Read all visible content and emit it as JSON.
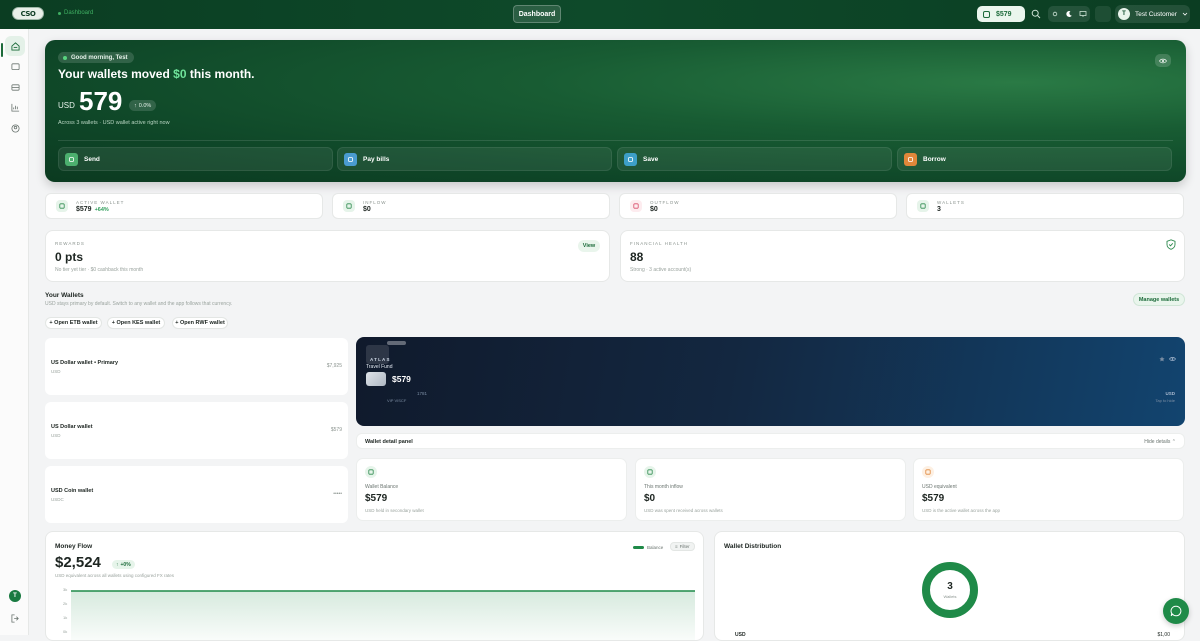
{
  "topbar": {
    "logo_text": "CSO",
    "breadcrumb": "Dashboard",
    "center_tab": "Dashboard",
    "balance_pill": "$579",
    "user_initial": "T",
    "user_name": "Test Customer"
  },
  "sidebar": {
    "items": [
      "home-icon",
      "wallet-icon",
      "mail-icon",
      "chart-icon",
      "user-circle-icon"
    ],
    "avatar_initial": "T"
  },
  "hero": {
    "greeting": "Good morning, Test",
    "title_prefix": "Your wallets moved ",
    "title_highlight": "$0",
    "title_suffix": " this month.",
    "currency": "USD",
    "amount": "579",
    "change": "0.0%",
    "subtitle": "Across 3 wallets · USD wallet active right now",
    "actions": [
      {
        "label": "Send",
        "icon": "send-icon",
        "color": "#4caf6e"
      },
      {
        "label": "Pay bills",
        "icon": "receipt-icon",
        "color": "#4a9bd1"
      },
      {
        "label": "Save",
        "icon": "piggy-bank-icon",
        "color": "#3d9fc7"
      },
      {
        "label": "Borrow",
        "icon": "hand-coin-icon",
        "color": "#e0873a"
      }
    ]
  },
  "stats": [
    {
      "label": "ACTIVE WALLET",
      "value": "$579",
      "extra": "+64%",
      "icon": "wallet-icon",
      "bg": "#e6f4ea",
      "fg": "#2d8a4e"
    },
    {
      "label": "INFLOW",
      "value": "$0",
      "extra": "",
      "icon": "trend-up-icon",
      "bg": "#e6f4ea",
      "fg": "#2d8a4e"
    },
    {
      "label": "OUTFLOW",
      "value": "$0",
      "extra": "",
      "icon": "trend-down-icon",
      "bg": "#fdecef",
      "fg": "#d94c6a"
    },
    {
      "label": "WALLETS",
      "value": "3",
      "extra": "",
      "icon": "layers-icon",
      "bg": "#e6f4ea",
      "fg": "#2d8a4e"
    }
  ],
  "rewards": {
    "label": "REWARDS",
    "value": "0 pts",
    "sub": "No tier yet tier · $0 cashback this month",
    "button": "View"
  },
  "health": {
    "label": "FINANCIAL HEALTH",
    "value": "88",
    "sub": "Strong · 3 active account(s)"
  },
  "wallets_section": {
    "title": "Your Wallets",
    "subtitle": "USD stays primary by default. Switch to any wallet and the app follows that currency.",
    "manage": "Manage wallets",
    "open_buttons": [
      "+ Open ETB wallet",
      "+ Open KES wallet",
      "+ Open RWF wallet"
    ],
    "list": [
      {
        "name": "US Dollar wallet • Primary",
        "code": "USD",
        "value": "$7,925"
      },
      {
        "name": "US Dollar wallet",
        "code": "USD",
        "value": "$579"
      },
      {
        "name": "USD Coin wallet",
        "code": "USDC",
        "value": "•••••"
      }
    ]
  },
  "atlas_card": {
    "brand": "ATLAS",
    "fund": "Travel Fund",
    "amount": "$579",
    "number": "1781",
    "tier": "VIP VISCF",
    "currency": "USD",
    "hide": "Tap to hide"
  },
  "detail": {
    "title": "Wallet detail panel",
    "hide": "Hide details",
    "cards": [
      {
        "label": "Wallet Balance",
        "value": "$579",
        "desc": "USD held in secondary wallet",
        "icon": "wallet-icon",
        "bg": "#e6f4ea",
        "fg": "#2d8a4e"
      },
      {
        "label": "This month inflow",
        "value": "$0",
        "desc": "USD was spent received across wallets",
        "icon": "arrow-down-circle-icon",
        "bg": "#e6f4ea",
        "fg": "#2d8a4e"
      },
      {
        "label": "USD equivalent",
        "value": "$579",
        "desc": "USD is the active wallet across the app",
        "icon": "exchange-icon",
        "bg": "#fdf0e3",
        "fg": "#e0873a"
      }
    ]
  },
  "money_flow": {
    "title": "Money Flow",
    "amount": "$2,524",
    "change": "+0%",
    "sub": "USD equivalent across all wallets using configured FX rates",
    "legend": "Balance",
    "filter": "Filter",
    "y_ticks": [
      "3k",
      "2k",
      "1k",
      "0k"
    ],
    "color": "#1f8a48"
  },
  "distribution": {
    "title": "Wallet Distribution",
    "count": "3",
    "count_label": "Wallets",
    "footer_left": "USD",
    "footer_right": "$1,00"
  }
}
